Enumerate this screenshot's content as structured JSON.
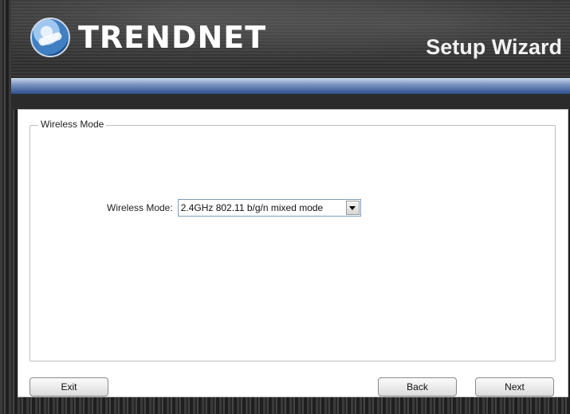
{
  "header": {
    "brand": "TRENDNET",
    "title": "Setup Wizard"
  },
  "group": {
    "legend": "Wireless Mode"
  },
  "field": {
    "label": "Wireless Mode:",
    "value": "2.4GHz 802.11 b/g/n mixed mode"
  },
  "buttons": {
    "exit": "Exit",
    "back": "Back",
    "next": "Next"
  },
  "colors": {
    "accent_bar": "#2f4f8c",
    "header_bg": "#303030"
  },
  "icons": {
    "logo": "trendnet-logo-icon",
    "dropdown": "chevron-down-icon"
  }
}
